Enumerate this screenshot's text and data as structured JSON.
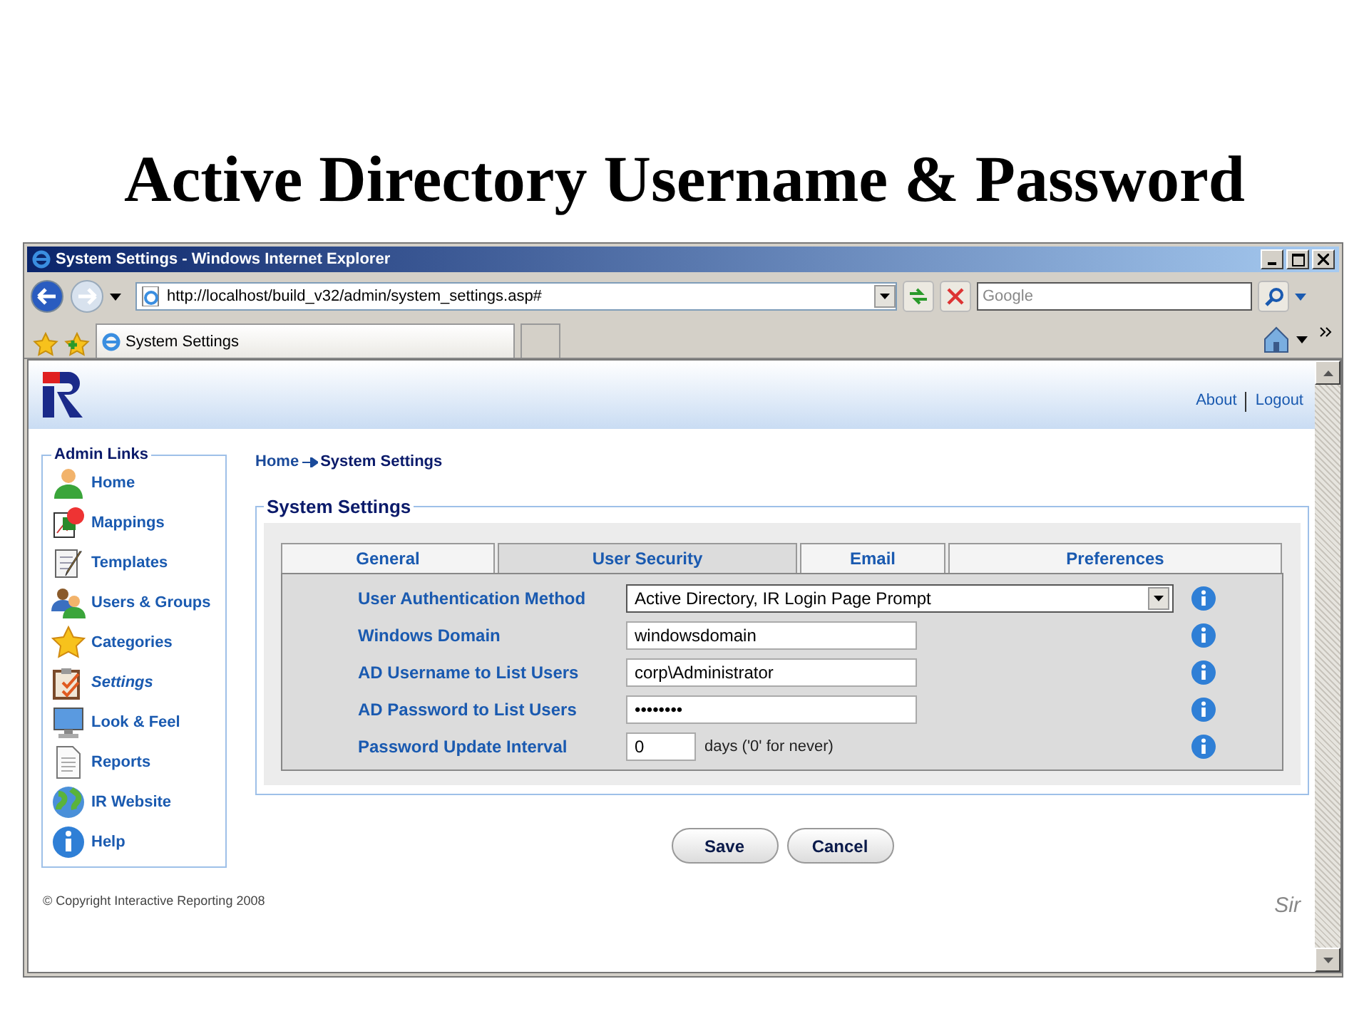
{
  "slide_title": "Active Directory Username & Password",
  "browser": {
    "title": "System Settings - Windows Internet Explorer",
    "address": "http://localhost/build_v32/admin/system_settings.asp#",
    "search": {
      "placeholder": "Google"
    },
    "tab": "System Settings"
  },
  "header": {
    "links": [
      "About",
      "Logout"
    ]
  },
  "sidebar": {
    "title": "Admin Links",
    "items": [
      {
        "label": "Home",
        "selected": false
      },
      {
        "label": "Mappings",
        "selected": false
      },
      {
        "label": "Templates",
        "selected": false
      },
      {
        "label": "Users & Groups",
        "selected": false
      },
      {
        "label": "Categories",
        "selected": false
      },
      {
        "label": "Settings",
        "selected": true
      },
      {
        "label": "Look & Feel",
        "selected": false
      },
      {
        "label": "Reports",
        "selected": false
      },
      {
        "label": "IR Website",
        "selected": false
      },
      {
        "label": "Help",
        "selected": false
      }
    ]
  },
  "breadcrumb": [
    "Home",
    "System Settings"
  ],
  "panel": {
    "title": "System Settings",
    "tabs": [
      {
        "label": "General",
        "selected": false
      },
      {
        "label": "User Security",
        "selected": true
      },
      {
        "label": "Email",
        "selected": false
      },
      {
        "label": "Preferences",
        "selected": false
      }
    ],
    "fields": [
      {
        "kind": "select",
        "label": "User Authentication Method",
        "value": "Active Directory, IR Login Page Prompt"
      },
      {
        "kind": "text",
        "label": "Windows Domain",
        "value": "windowsdomain"
      },
      {
        "kind": "text",
        "label": "AD Username to List Users",
        "value": "corp\\Administrator"
      },
      {
        "kind": "password",
        "label": "AD Password to List Users",
        "value": "••••••••"
      },
      {
        "kind": "number",
        "label": "Password Update Interval",
        "value": "0",
        "suffix": "days ('0' for never)"
      }
    ]
  },
  "buttons": [
    "Save",
    "Cancel"
  ],
  "footer": {
    "copyright": "© Copyright Interactive Reporting 2008",
    "signature": "Sir"
  }
}
